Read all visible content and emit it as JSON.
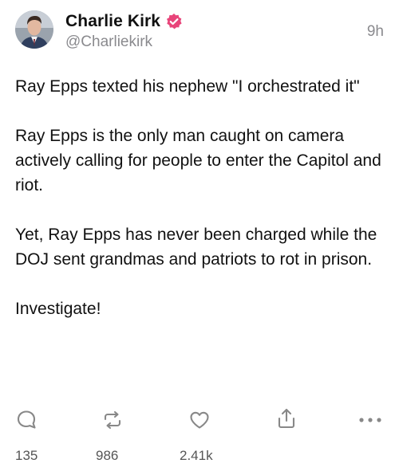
{
  "post": {
    "author": {
      "display_name": "Charlie Kirk",
      "handle": "@Charliekirk",
      "verified": true,
      "verified_badge_color": "#e8457a",
      "avatar_icon": "user-avatar"
    },
    "timestamp": "9h",
    "paragraphs": [
      "Ray Epps texted his nephew \"I orchestrated it\"",
      "Ray Epps is the only man caught on camera actively calling for people to enter the Capitol and riot.",
      "Yet, Ray Epps has never been charged while the DOJ sent grandmas and patriots to rot in prison.",
      "Investigate!"
    ],
    "actions": {
      "reply": {
        "icon": "reply-bubble-icon",
        "count": "135"
      },
      "repost": {
        "icon": "repost-icon",
        "count": "986"
      },
      "like": {
        "icon": "heart-icon",
        "count": "2.41k"
      },
      "share": {
        "icon": "share-icon"
      },
      "more": {
        "icon": "more-dots-icon"
      }
    }
  },
  "colors": {
    "text": "#111111",
    "secondary_text": "#8a8a8e",
    "icon": "#888888",
    "count_text": "#555555"
  }
}
